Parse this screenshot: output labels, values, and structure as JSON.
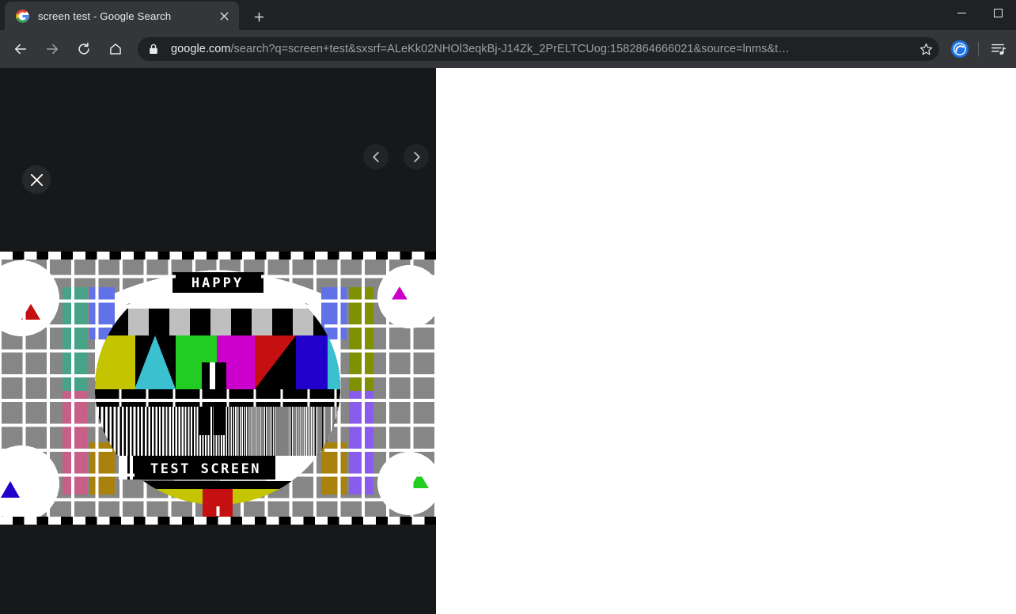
{
  "window": {
    "controls": [
      {
        "name": "minimize",
        "glyph": "minimize"
      },
      {
        "name": "maximize",
        "glyph": "maximize"
      }
    ]
  },
  "tabstrip": {
    "tabs": [
      {
        "title": "screen test - Google Search",
        "favicon": "google-g-icon",
        "close_label": "×",
        "active": true
      }
    ],
    "new_tab_label": "+"
  },
  "toolbar": {
    "back_label": "←",
    "forward_label": "→",
    "reload_label": "↻",
    "home_label": "⌂",
    "security_icon": "lock-icon",
    "url_host": "google.com",
    "url_path": "/search?q=screen+test&sxsrf=ALeKk02NHOl3eqkBj-J14Zk_2PrELTCUog:1582864666021&source=lnms&t…",
    "url_full": "google.com/search?q=screen+test&sxsrf=ALeKk02NHOl3eqkBj-J14Zk_2PrELTCUog:1582864666021&source=lnms&t…",
    "bookmark_icon": "star-icon",
    "extension_icon": "extension-blue-circle-icon",
    "media_icon": "media-playlist-icon",
    "menu_icon": "menu-icon"
  },
  "lightbox": {
    "close_label": "×",
    "prev_label": "‹",
    "next_label": "›",
    "background": "#17181a"
  },
  "testcard": {
    "title_top": "HAPPY",
    "title_bottom": "TEST SCREEN",
    "colors": {
      "grid_cell": "#868686",
      "grid_line": "#ffffff",
      "black": "#000000",
      "white": "#ffffff",
      "teal_green": "#46a387",
      "rose": "#c75f87",
      "cornflower_blue": "#6172e8",
      "dark_gold": "#a8820c",
      "olive": "#7f9100",
      "purple": "#8a5ced",
      "yellow": "#c4c400",
      "cyan": "#3bc0cf",
      "green": "#22cc22",
      "magenta": "#cc00cc",
      "red": "#c41010",
      "blue": "#2200cc",
      "corner_tri_red": "#c41010",
      "corner_tri_magenta": "#cc00cc",
      "corner_tri_blue": "#2200cc",
      "corner_tri_green": "#22cc22",
      "light_gray": "#bfbfbf"
    },
    "grayscale_steps": [
      "#000000",
      "#333333",
      "#6b6b6b",
      "#a0a0a0",
      "#d0d0d0",
      "#ffffff"
    ],
    "corner_markers": [
      {
        "position": "top-left",
        "triangle_color": "#c41010"
      },
      {
        "position": "top-right",
        "triangle_color": "#cc00cc"
      },
      {
        "position": "bottom-left",
        "triangle_color": "#2200cc"
      },
      {
        "position": "bottom-right",
        "triangle_color": "#22cc22"
      }
    ],
    "color_bars_left": [
      {
        "color": "#46a387",
        "half": "top"
      },
      {
        "color": "#c75f87",
        "half": "bottom"
      },
      {
        "color": "#6172e8",
        "half": "top"
      },
      {
        "color": "#a8820c",
        "half": "bottom"
      }
    ],
    "color_bars_right": [
      {
        "color": "#6172e8",
        "half": "top"
      },
      {
        "color": "#a8820c",
        "half": "bottom"
      },
      {
        "color": "#7f9100",
        "half": "top"
      },
      {
        "color": "#8a5ced",
        "half": "bottom"
      }
    ],
    "center_color_blocks": [
      "#c4c400",
      "#3bc0cf",
      "#22cc22",
      "#cc00cc",
      "#c41010",
      "#2200cc",
      "#c4c400",
      "#3bc0cf"
    ]
  }
}
